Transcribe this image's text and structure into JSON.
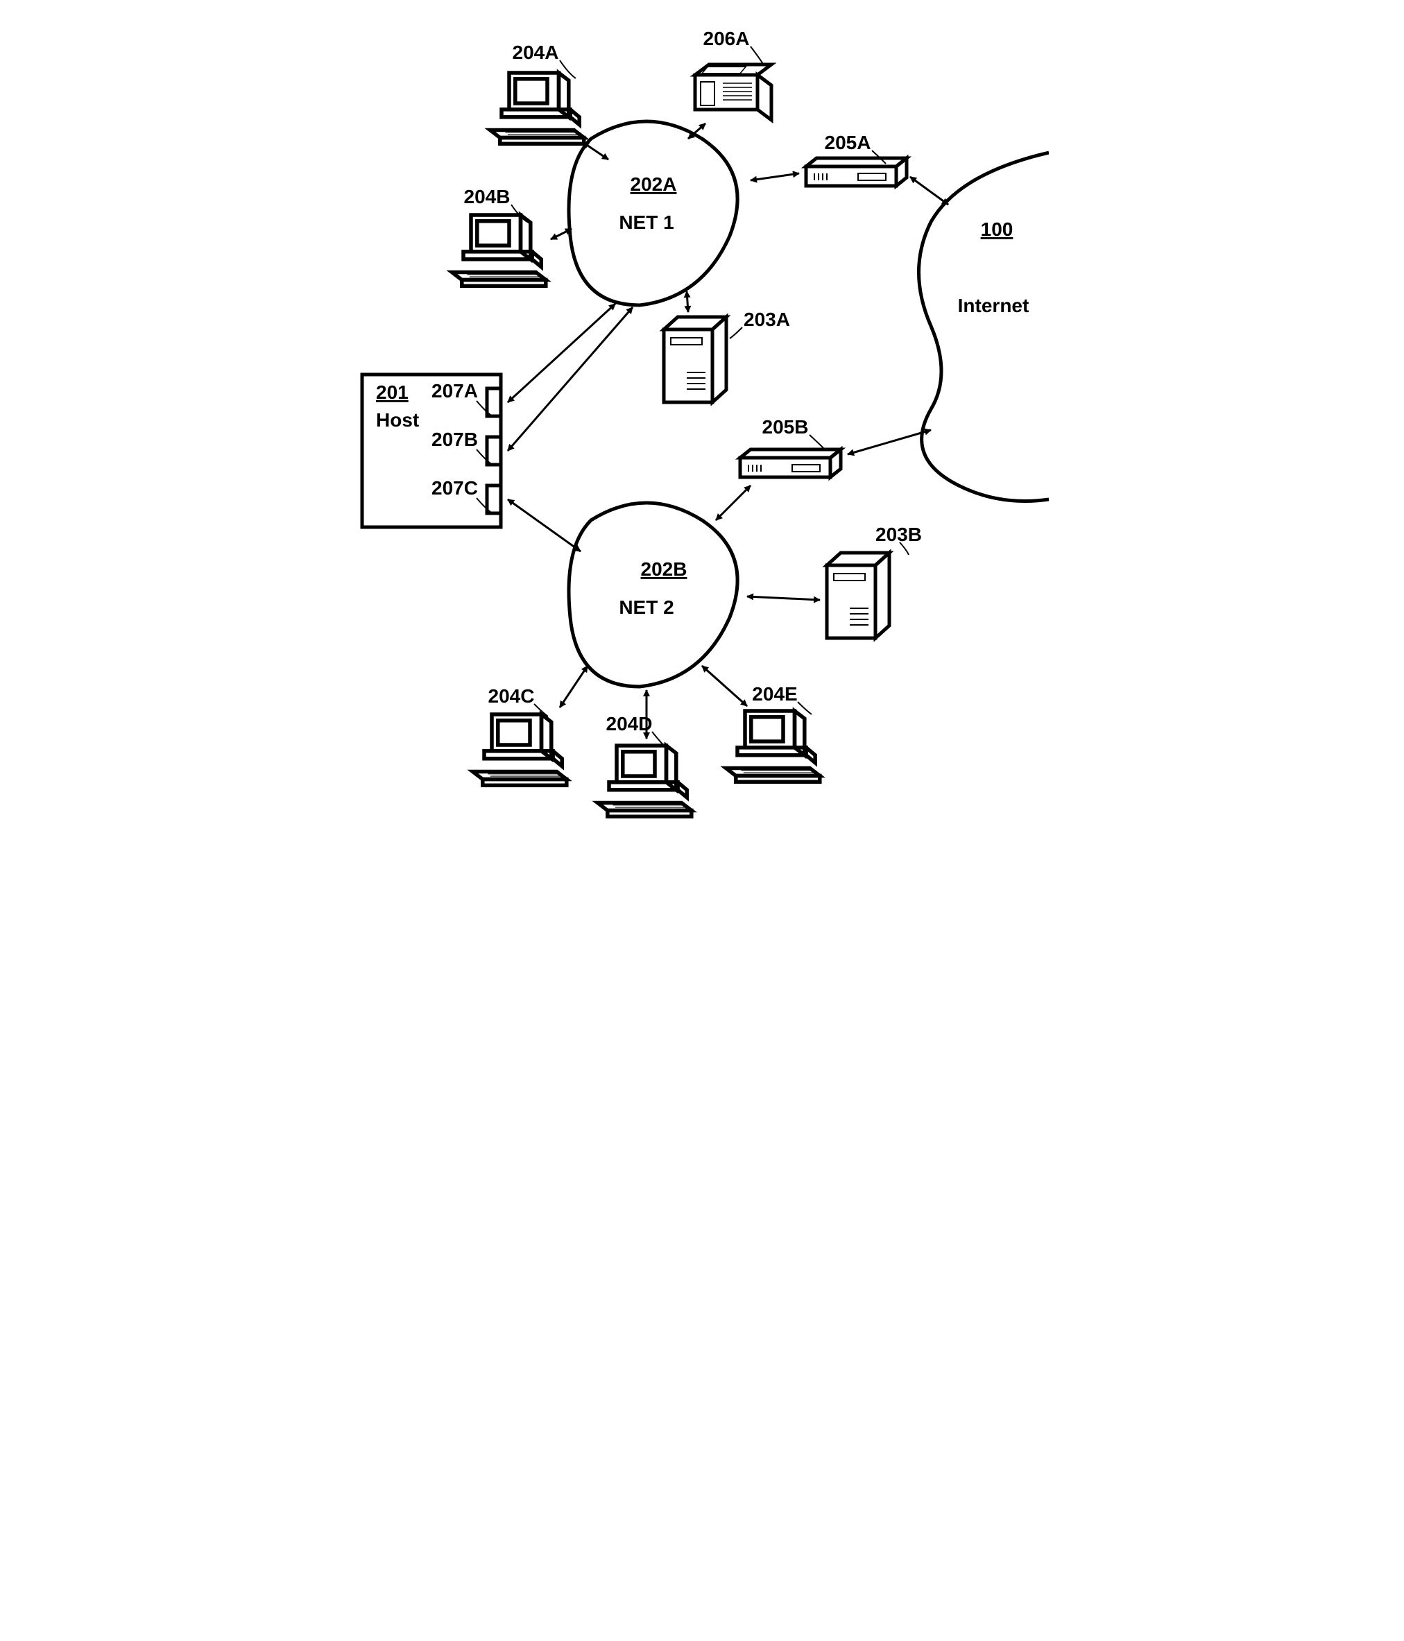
{
  "net1": {
    "id": "202A",
    "name": "NET 1"
  },
  "net2": {
    "id": "202B",
    "name": "NET 2"
  },
  "internet": {
    "id": "100",
    "name": "Internet"
  },
  "host": {
    "id": "201",
    "name": "Host"
  },
  "ports": {
    "a": "207A",
    "b": "207B",
    "c": "207C"
  },
  "computers": {
    "a": "204A",
    "b": "204B",
    "c": "204C",
    "d": "204D",
    "e": "204E"
  },
  "servers": {
    "a": "203A",
    "b": "203B"
  },
  "routers": {
    "a": "205A",
    "b": "205B"
  },
  "printer": "206A"
}
